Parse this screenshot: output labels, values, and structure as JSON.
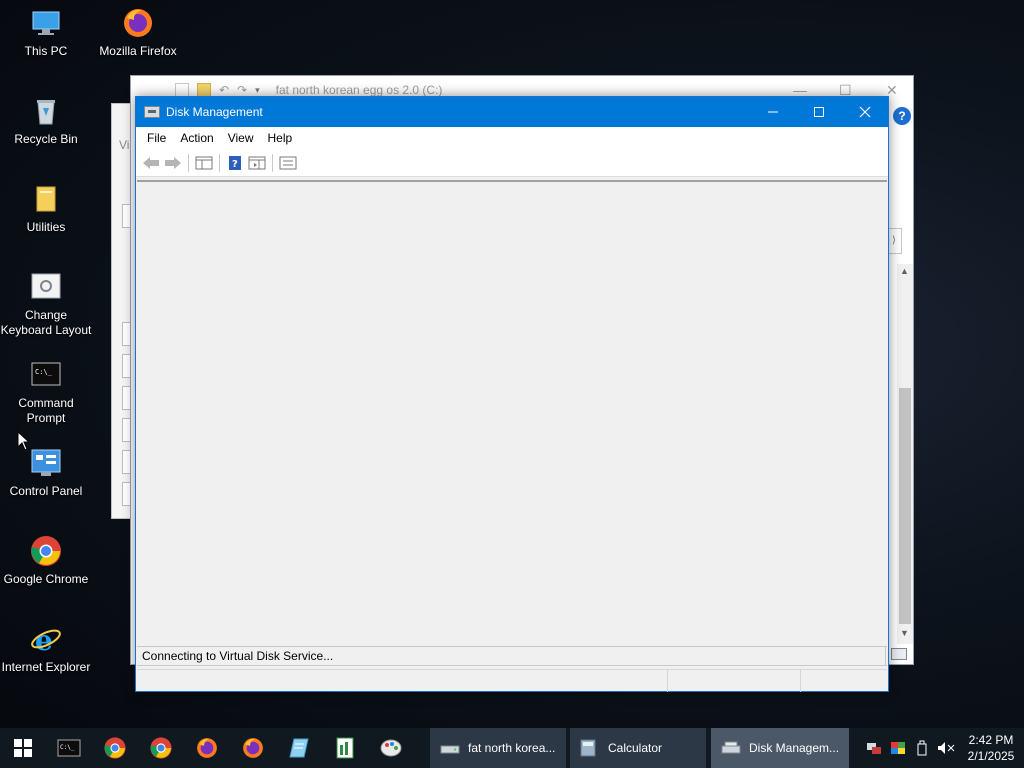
{
  "desktop": {
    "icons": [
      {
        "label": "This PC"
      },
      {
        "label": "Mozilla Firefox"
      },
      {
        "label": "Recycle Bin"
      },
      {
        "label": "Utilities"
      },
      {
        "label": "Change Keyboard Layout"
      },
      {
        "label": "Command Prompt"
      },
      {
        "label": "Control Panel"
      },
      {
        "label": "Google Chrome"
      },
      {
        "label": "Internet Explorer"
      }
    ]
  },
  "background_window": {
    "title": "fat north korean egg os 2.0 (C:)",
    "view_label": "Vie",
    "help_label": "?"
  },
  "disk_management": {
    "title": "Disk Management",
    "menu": [
      "File",
      "Action",
      "View",
      "Help"
    ],
    "status": "Connecting to Virtual Disk Service...",
    "accent_color": "#0078d7"
  },
  "taskbar": {
    "tasks": [
      {
        "label": "fat north korea..."
      },
      {
        "label": "Calculator"
      },
      {
        "label": "Disk Managem..."
      }
    ],
    "clock": {
      "time": "2:42 PM",
      "date": "2/1/2025"
    }
  }
}
